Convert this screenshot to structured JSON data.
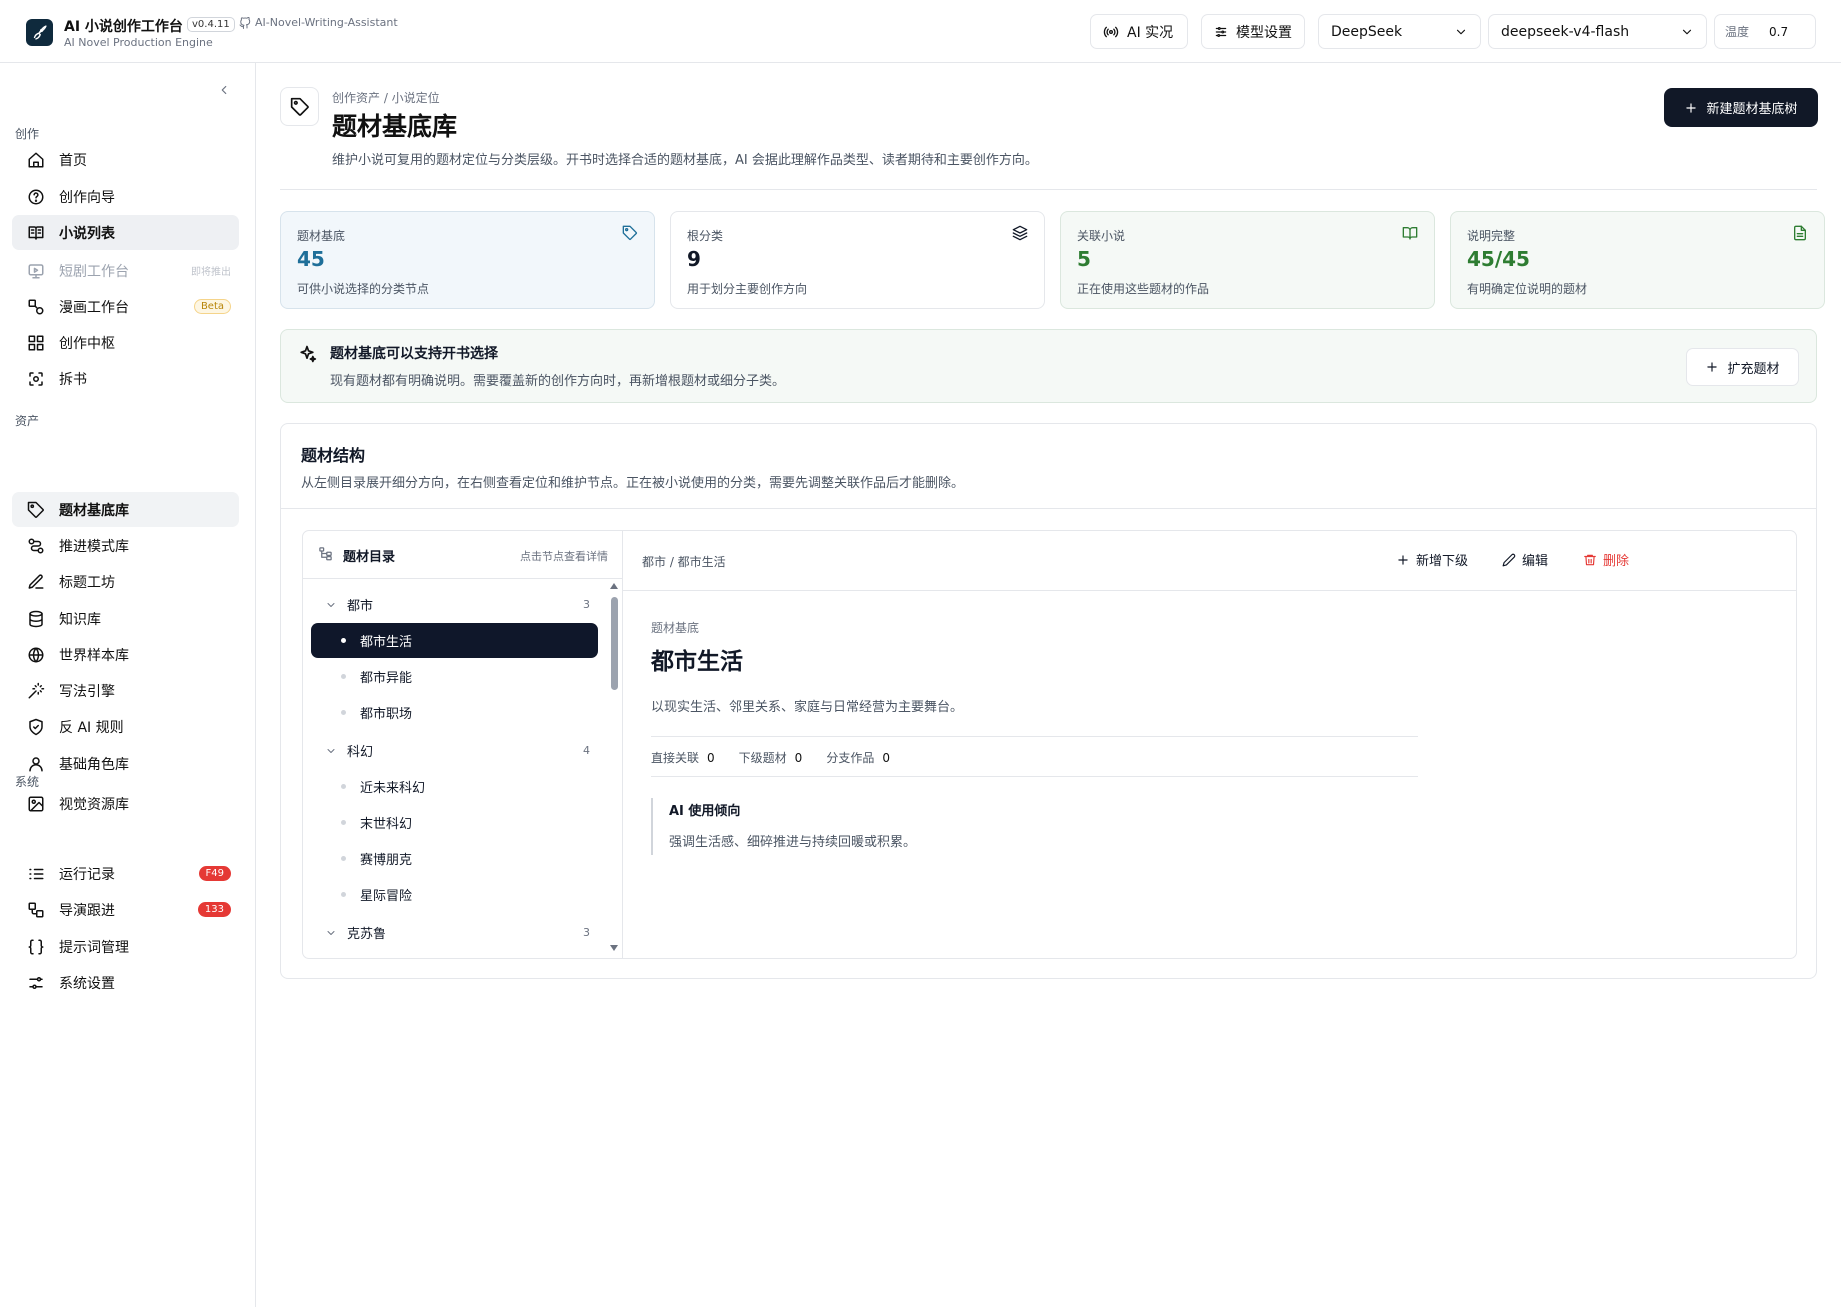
{
  "header": {
    "app_title": "AI 小说创作工作台",
    "version": "v0.4.11",
    "repo": "AI-Novel-Writing-Assistant",
    "subtitle": "AI Novel Production Engine",
    "live_label": "AI 实况",
    "model_settings_label": "模型设置",
    "provider": "DeepSeek",
    "model": "deepseek-v4-flash",
    "temperature_label": "温度",
    "temperature_value": "0.7"
  },
  "sidebar": {
    "section_create": "创作",
    "section_assets": "资产",
    "section_system": "系统",
    "create_items": [
      {
        "label": "首页",
        "icon": "home-icon"
      },
      {
        "label": "创作向导",
        "icon": "help-circle-icon"
      },
      {
        "label": "小说列表",
        "icon": "book-list-icon",
        "active": true
      },
      {
        "label": "短剧工作台",
        "icon": "monitor-icon",
        "tag": "即将推出",
        "disabled": true
      },
      {
        "label": "漫画工作台",
        "icon": "shapes-icon",
        "tag": "Beta"
      },
      {
        "label": "创作中枢",
        "icon": "grid-icon"
      },
      {
        "label": "拆书",
        "icon": "scan-icon"
      }
    ],
    "asset_items": [
      {
        "label": "题材基底库",
        "icon": "tag-icon",
        "active": true
      },
      {
        "label": "推进模式库",
        "icon": "flow-icon"
      },
      {
        "label": "标题工坊",
        "icon": "edit-icon"
      },
      {
        "label": "知识库",
        "icon": "database-icon"
      },
      {
        "label": "世界样本库",
        "icon": "globe-icon"
      },
      {
        "label": "写法引擎",
        "icon": "wand-icon"
      },
      {
        "label": "反 AI 规则",
        "icon": "shield-icon"
      },
      {
        "label": "基础角色库",
        "icon": "user-icon"
      },
      {
        "label": "视觉资源库",
        "icon": "image-icon"
      }
    ],
    "system_items": [
      {
        "label": "运行记录",
        "icon": "list-icon",
        "badge": "F49"
      },
      {
        "label": "导演跟进",
        "icon": "workflow-icon",
        "badge": "133"
      },
      {
        "label": "提示词管理",
        "icon": "braces-icon"
      },
      {
        "label": "系统设置",
        "icon": "sliders-icon"
      }
    ]
  },
  "page": {
    "breadcrumb": "创作资产 / 小说定位",
    "title": "题材基底库",
    "description": "维护小说可复用的题材定位与分类层级。开书时选择合适的题材基底，AI 会据此理解作品类型、读者期待和主要创作方向。",
    "new_button": "新建题材基底树"
  },
  "stats": [
    {
      "label": "题材基底",
      "value": "45",
      "note": "可供小说选择的分类节点",
      "icon": "tag-icon",
      "color": "#1f6f99"
    },
    {
      "label": "根分类",
      "value": "9",
      "note": "用于划分主要创作方向",
      "icon": "layers-icon",
      "color": "#111827"
    },
    {
      "label": "关联小说",
      "value": "5",
      "note": "正在使用这些题材的作品",
      "icon": "book-open-icon",
      "color": "#2e7d32"
    },
    {
      "label": "说明完整",
      "value": "45/45",
      "note": "有明确定位说明的题材",
      "icon": "file-text-icon",
      "color": "#2e7d32"
    }
  ],
  "notice": {
    "title": "题材基底可以支持开书选择",
    "description": "现有题材都有明确说明。需要覆盖新的创作方向时，再新增根题材或细分子类。",
    "button": "扩充题材"
  },
  "structure": {
    "title": "题材结构",
    "description": "从左侧目录展开细分方向，在右侧查看定位和维护节点。正在被小说使用的分类，需要先调整关联作品后才能删除。",
    "tree_title": "题材目录",
    "tree_hint": "点击节点查看详情",
    "nodes": [
      {
        "label": "都市",
        "type": "parent",
        "count": "3"
      },
      {
        "label": "都市生活",
        "type": "child",
        "selected": true
      },
      {
        "label": "都市异能",
        "type": "child"
      },
      {
        "label": "都市职场",
        "type": "child"
      },
      {
        "label": "科幻",
        "type": "parent",
        "count": "4"
      },
      {
        "label": "近未来科幻",
        "type": "child"
      },
      {
        "label": "末世科幻",
        "type": "child"
      },
      {
        "label": "赛博朋克",
        "type": "child"
      },
      {
        "label": "星际冒险",
        "type": "child"
      },
      {
        "label": "克苏鲁",
        "type": "parent",
        "count": "3"
      }
    ],
    "detail": {
      "path": "都市 / 都市生活",
      "add_child": "新增下级",
      "edit": "编辑",
      "delete": "删除",
      "kind": "题材基底",
      "title": "都市生活",
      "description": "以现实生活、邻里关系、家庭与日常经营为主要舞台。",
      "direct_label": "直接关联",
      "direct_value": "0",
      "sub_label": "下级题材",
      "sub_value": "0",
      "branch_label": "分支作品",
      "branch_value": "0",
      "ai_title": "AI 使用倾向",
      "ai_desc": "强调生活感、细碎推进与持续回暖或积累。"
    }
  }
}
